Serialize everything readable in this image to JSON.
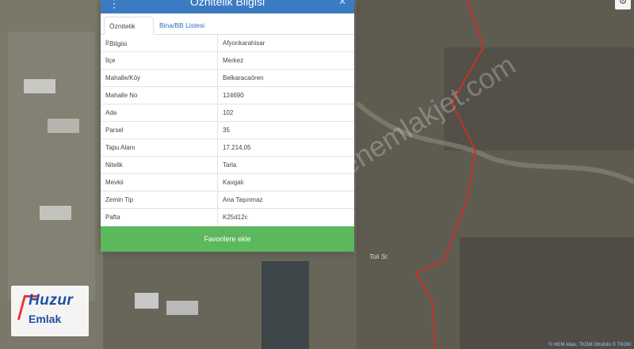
{
  "panel": {
    "title": "Öznitelik Bilgisi",
    "tabs": [
      {
        "label": "Öznitelik Bilgisi"
      },
      {
        "label": "Bina/BB Listesi"
      }
    ],
    "rows": [
      {
        "label": "İl",
        "value": "Afyonkarahisar"
      },
      {
        "label": "İlçe",
        "value": "Merkez"
      },
      {
        "label": "Mahalle/Köy",
        "value": "Belkaracaören"
      },
      {
        "label": "Mahalle No",
        "value": "124690"
      },
      {
        "label": "Ada",
        "value": "102"
      },
      {
        "label": "Parsel",
        "value": "35"
      },
      {
        "label": "Tapu Alanı",
        "value": "17.214,05"
      },
      {
        "label": "Nitelik",
        "value": "Tarla"
      },
      {
        "label": "Mevkii",
        "value": "Kavgalı"
      },
      {
        "label": "Zemin Tip",
        "value": "Ana Taşınmaz"
      },
      {
        "label": "Pafta",
        "value": "K25d12c"
      }
    ],
    "favorite_label": "Favorilere ekle"
  },
  "map": {
    "watermark": "sahibindenemlakjet.com",
    "street_label": "Tolı Sr.",
    "attribution": "© HGM Atlas, TKGM Ortofoto © TKGM"
  },
  "logo": {
    "top": "Huzur",
    "bottom": "Emlak"
  },
  "colors": {
    "header": "#3b7bc4",
    "favorite_button": "#5cb85c",
    "boundary": "#c9302c"
  }
}
